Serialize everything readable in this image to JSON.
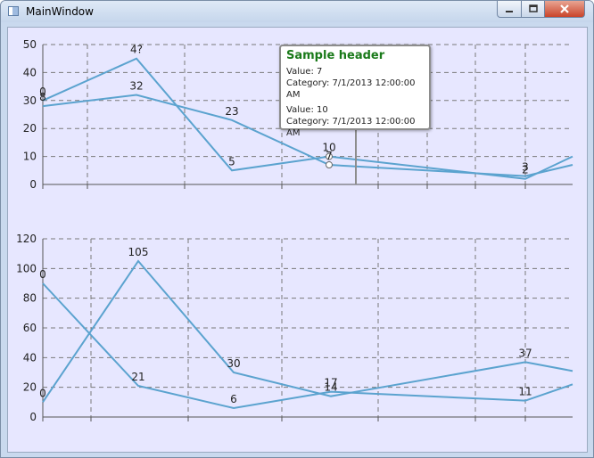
{
  "window": {
    "title": "MainWindow",
    "colors": {
      "accent": "#5ba3cf",
      "plot_background": "#e7e7ff",
      "tooltip_header": "#1a7a1a"
    },
    "icons": {
      "app": "window-app-icon",
      "minimize": "minimize-icon",
      "maximize": "maximize-icon",
      "close": "close-icon"
    }
  },
  "tooltip": {
    "header": "Sample header",
    "entries": [
      {
        "value": "Value: 7",
        "category": "Category: 7/1/2013 12:00:00 AM"
      },
      {
        "value": "Value: 10",
        "category": "Category: 7/1/2013 12:00:00 AM"
      }
    ]
  },
  "chart_data": [
    {
      "type": "line",
      "ylim": [
        0,
        50
      ],
      "yticks": [
        "0",
        "10",
        "20",
        "30",
        "40",
        "50"
      ],
      "grid": true,
      "x": [
        0,
        1,
        2,
        3,
        4,
        5
      ],
      "series": [
        {
          "values": [
            30,
            45,
            5,
            10,
            2,
            10
          ],
          "labels": [
            "0",
            "4?",
            "5",
            "10",
            "2",
            ""
          ]
        },
        {
          "values": [
            28,
            32,
            23,
            7,
            3,
            7
          ],
          "labels": [
            "8",
            "32",
            "23",
            "7",
            "3",
            ""
          ]
        }
      ]
    },
    {
      "type": "line",
      "ylim": [
        0,
        120
      ],
      "yticks": [
        "0",
        "20",
        "40",
        "60",
        "80",
        "100",
        "120"
      ],
      "grid": true,
      "x": [
        0,
        1,
        2,
        3,
        4,
        5
      ],
      "series": [
        {
          "values": [
            90,
            21,
            6,
            17,
            11,
            22
          ],
          "labels": [
            "0",
            "21",
            "6",
            "17",
            "11",
            ""
          ]
        },
        {
          "values": [
            10,
            105,
            30,
            14,
            37,
            31
          ],
          "labels": [
            "0",
            "105",
            "30",
            "14",
            "37",
            ""
          ]
        }
      ]
    }
  ]
}
